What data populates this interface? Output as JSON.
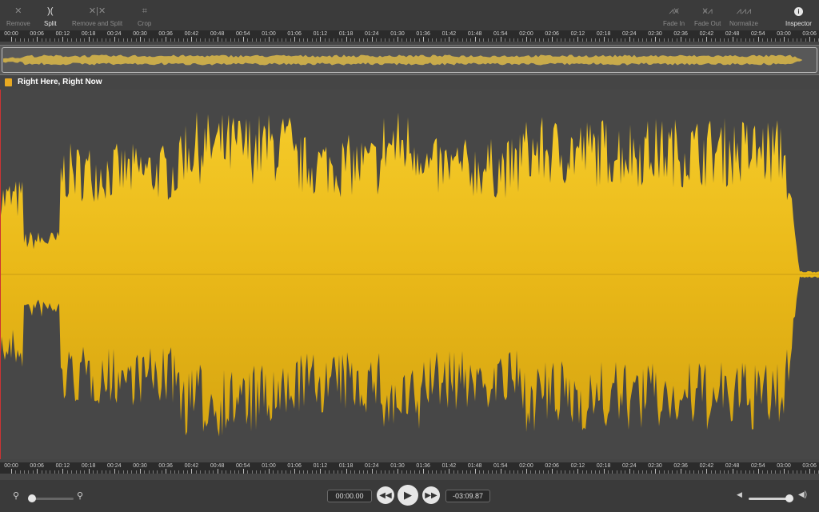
{
  "toolbar": {
    "remove_label": "Remove",
    "split_label": "Split",
    "remove_split_label": "Remove and Split",
    "crop_label": "Crop",
    "fade_in_label": "Fade In",
    "fade_out_label": "Fade Out",
    "normalize_label": "Normalize",
    "inspector_label": "Inspector"
  },
  "ruler": {
    "ticks": [
      "00:00",
      "00:06",
      "00:12",
      "00:18",
      "00:24",
      "00:30",
      "00:36",
      "00:42",
      "00:48",
      "00:54",
      "01:00",
      "01:06",
      "01:12",
      "01:18",
      "01:24",
      "01:30",
      "01:36",
      "01:42",
      "01:48",
      "01:54",
      "02:00",
      "02:06",
      "02:12",
      "02:18",
      "02:24",
      "02:30",
      "02:36",
      "02:42",
      "02:48",
      "02:54",
      "03:00",
      "03:06"
    ]
  },
  "track": {
    "title": "Right Here, Right Now"
  },
  "transport": {
    "current_time": "00:00.00",
    "remaining_time": "-03:09.87"
  },
  "colors": {
    "waveform": "#f2c21e",
    "waveform_dark": "#d8a812",
    "background": "#454545"
  }
}
